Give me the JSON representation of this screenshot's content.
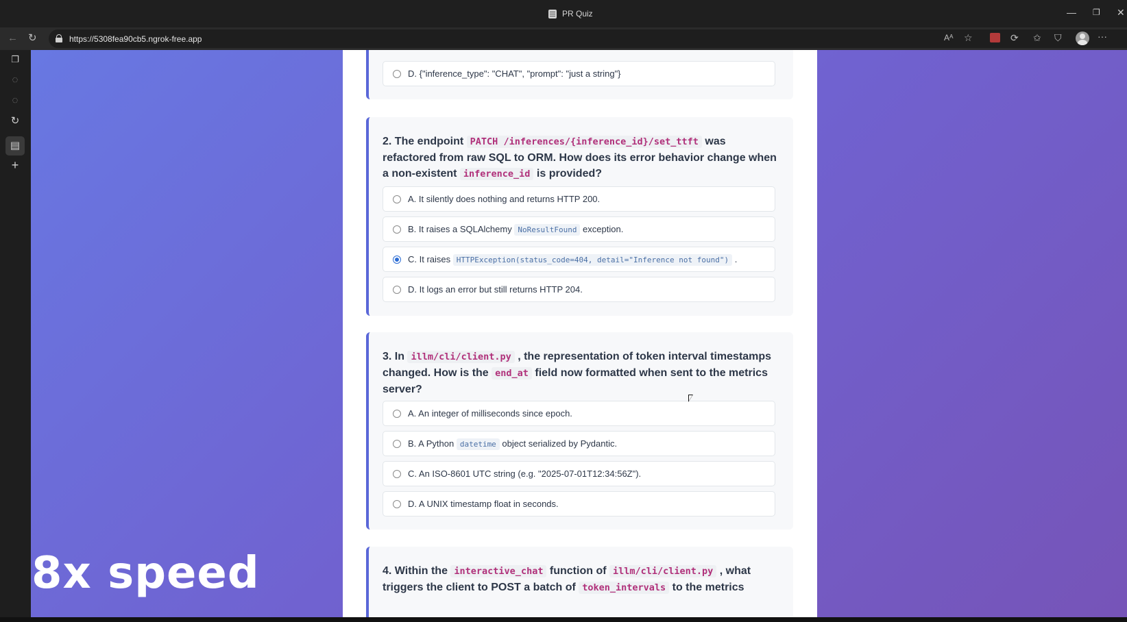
{
  "window": {
    "title": "PR Quiz",
    "controls": {
      "minimize": "—",
      "restore": "❐",
      "close": "✕"
    }
  },
  "address": {
    "url": "https://5308fea90cb5.ngrok-free.app",
    "read_aloud": "Aᴬ",
    "more": "···"
  },
  "overlay": {
    "speed_label": "8x speed"
  },
  "quiz": {
    "q1": {
      "options": [
        {
          "label": "D. {\"inference_type\": \"CHAT\", \"prompt\": \"just a string\"}"
        }
      ]
    },
    "q2": {
      "text_1": "2. The endpoint ",
      "code_1": "PATCH /inferences/{inference_id}/set_ttft",
      "text_2": " was refactored from raw SQL to ORM. How does its error behavior change when a non-existent ",
      "code_2": "inference_id",
      "text_3": " is provided?",
      "options": [
        {
          "label": "A. It silently does nothing and returns HTTP 200."
        },
        {
          "label_pre": "B. It raises a SQLAlchemy ",
          "code": "NoResultFound",
          "label_post": " exception."
        },
        {
          "label_pre": "C. It raises ",
          "code": "HTTPException(status_code=404, detail=\"Inference not found\")",
          "label_post": " ."
        },
        {
          "label": "D. It logs an error but still returns HTTP 204."
        }
      ]
    },
    "q3": {
      "text_1": "3. In ",
      "code_1": "illm/cli/client.py",
      "text_2": " , the representation of token interval timestamps changed. How is the ",
      "code_2": "end_at",
      "text_3": " field now formatted when sent to the metrics server?",
      "options": [
        {
          "label": "A. An integer of milliseconds since epoch."
        },
        {
          "label_pre": "B. A Python ",
          "code": "datetime",
          "label_post": " object serialized by Pydantic."
        },
        {
          "label": "C. An ISO-8601 UTC string (e.g. \"2025-07-01T12:34:56Z\")."
        },
        {
          "label": "D. A UNIX timestamp float in seconds."
        }
      ]
    },
    "q4": {
      "text_1": "4. Within the ",
      "code_1": "interactive_chat",
      "text_2": " function of ",
      "code_2": "illm/cli/client.py",
      "text_3": " , what triggers the client to POST a batch of ",
      "code_3": "token_intervals",
      "text_4": " to the metrics"
    }
  }
}
